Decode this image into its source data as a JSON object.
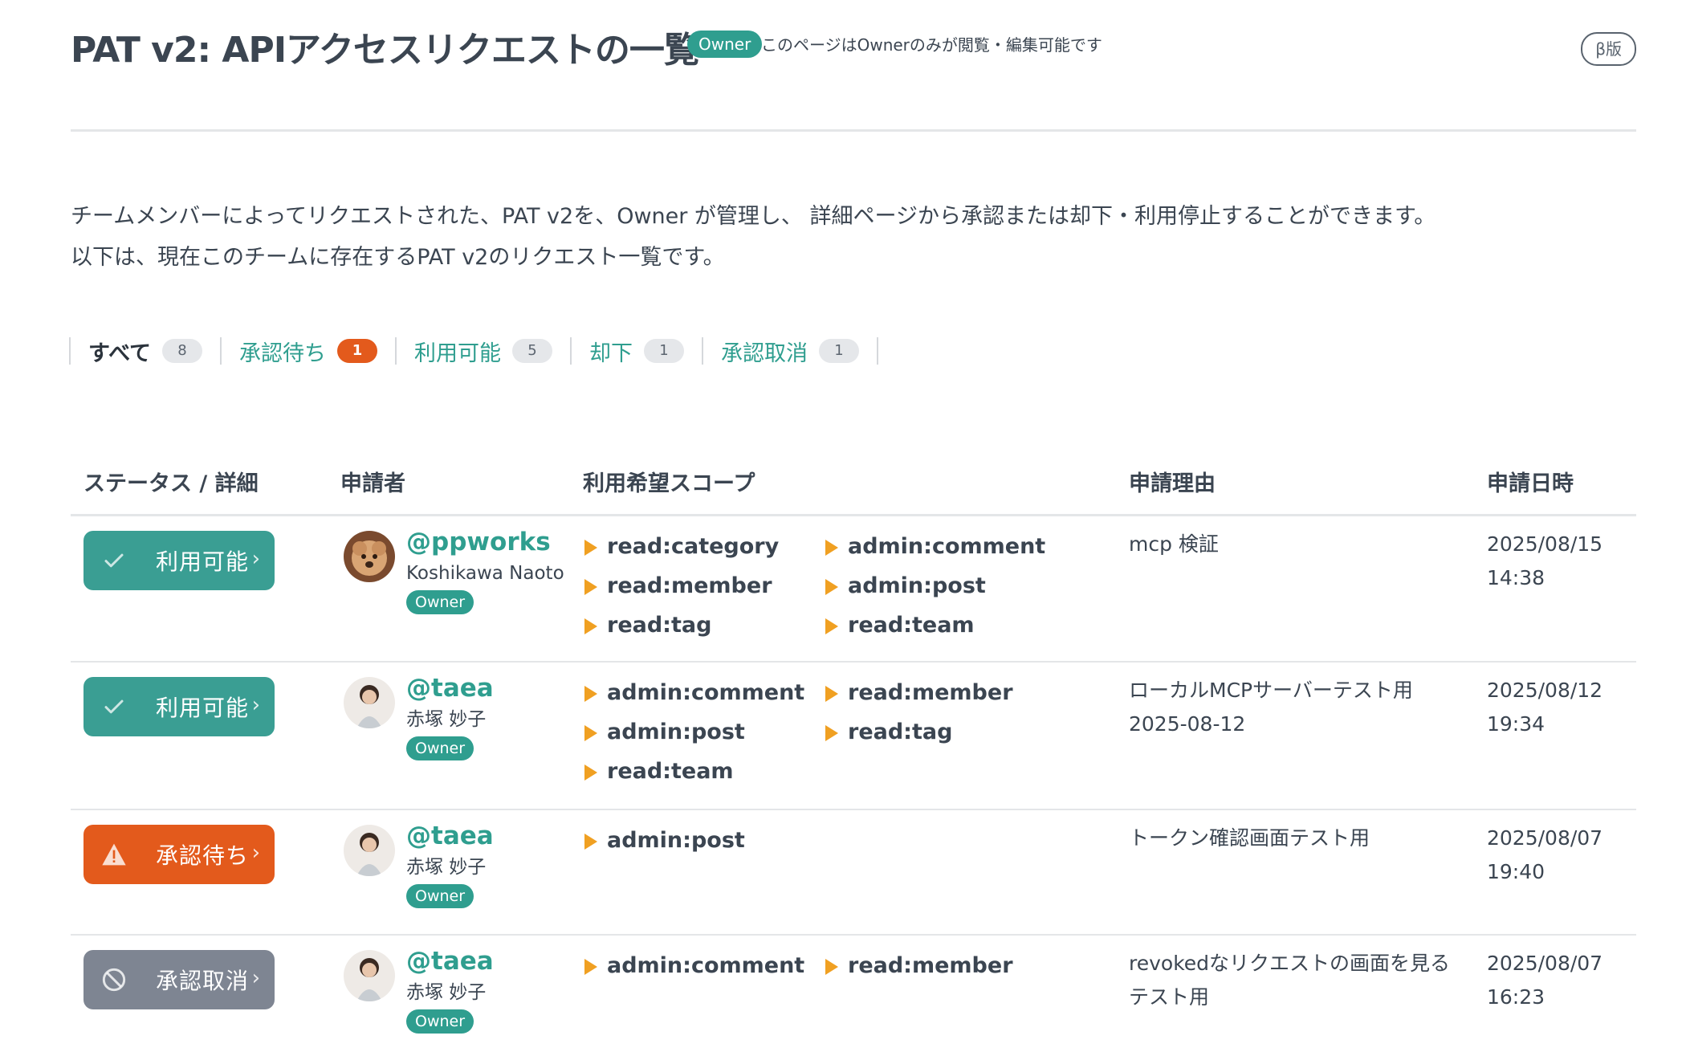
{
  "header": {
    "title": "PAT v2: APIアクセスリクエストの一覧",
    "owner_badge": "Owner",
    "owner_note": "このページはOwnerのみが閲覧・編集可能です",
    "beta_label": "β版"
  },
  "intro": {
    "line1": "チームメンバーによってリクエストされた、PAT v2を、Owner が管理し、 詳細ページから承認または却下・利用停止することができます。",
    "line2": "以下は、現在このチームに存在するPAT v2のリクエスト一覧です。"
  },
  "tabs": [
    {
      "label": "すべて",
      "count": "8",
      "active": true
    },
    {
      "label": "承認待ち",
      "count": "1",
      "alert": true
    },
    {
      "label": "利用可能",
      "count": "5"
    },
    {
      "label": "却下",
      "count": "1"
    },
    {
      "label": "承認取消",
      "count": "1"
    }
  ],
  "table": {
    "headers": {
      "status": "ステータス / 詳細",
      "applicant": "申請者",
      "scope": "利用希望スコープ",
      "reason": "申請理由",
      "date": "申請日時"
    },
    "rows": [
      {
        "status": "利用可能",
        "status_type": "available",
        "status_icon": "check-icon",
        "handle": "@ppworks",
        "name": "Koshikawa Naoto",
        "role": "Owner",
        "avatar": "dog-avatar",
        "scopes": [
          "read:category",
          "admin:comment",
          "read:member",
          "admin:post",
          "read:tag",
          "read:team"
        ],
        "reason_lines": [
          "mcp 検証"
        ],
        "date": "2025/08/15",
        "time": "14:38"
      },
      {
        "status": "利用可能",
        "status_type": "available",
        "status_icon": "check-icon",
        "handle": "@taea",
        "name": "赤塚 妙子",
        "role": "Owner",
        "avatar": "person-avatar",
        "scopes": [
          "admin:comment",
          "read:member",
          "admin:post",
          "read:tag",
          "read:team"
        ],
        "reason_lines": [
          "ローカルMCPサーバーテスト用",
          "2025-08-12"
        ],
        "date": "2025/08/12",
        "time": "19:34"
      },
      {
        "status": "承認待ち",
        "status_type": "pending",
        "status_icon": "warning-icon",
        "handle": "@taea",
        "name": "赤塚 妙子",
        "role": "Owner",
        "avatar": "person-avatar",
        "scopes": [
          "admin:post"
        ],
        "reason_lines": [
          "トークン確認画面テスト用"
        ],
        "date": "2025/08/07",
        "time": "19:40"
      },
      {
        "status": "承認取消",
        "status_type": "revoked",
        "status_icon": "prohibited-icon",
        "handle": "@taea",
        "name": "赤塚 妙子",
        "role": "Owner",
        "avatar": "person-avatar",
        "scopes": [
          "admin:comment",
          "read:member"
        ],
        "reason_lines": [
          "revokedなリクエストの画面を見る",
          "テスト用"
        ],
        "date": "2025/08/07",
        "time": "16:23"
      }
    ]
  },
  "colors": {
    "accent": "#2f9e8f",
    "available": "#3a9e93",
    "pending": "#e35a1c",
    "revoked": "#7e8592",
    "scope_marker": "#f0a022"
  }
}
